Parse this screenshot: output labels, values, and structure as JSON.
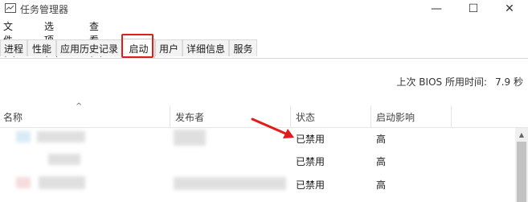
{
  "window": {
    "title": "任务管理器"
  },
  "controls": {
    "minimize": "—",
    "maximize": "☐",
    "close": "✕"
  },
  "menu": {
    "file": "文件(F)",
    "options": "选项(O)",
    "view": "查看(V)"
  },
  "tabs": [
    {
      "label": "进程"
    },
    {
      "label": "性能"
    },
    {
      "label": "应用历史记录"
    },
    {
      "label": "启动",
      "selected": true
    },
    {
      "label": "用户"
    },
    {
      "label": "详细信息"
    },
    {
      "label": "服务"
    }
  ],
  "bios": {
    "label": "上次 BIOS 所用时间:",
    "value": "7.9 秒"
  },
  "columns": {
    "sort_indicator": "^",
    "name": "名称",
    "publisher": "发布者",
    "status": "状态",
    "impact": "启动影响"
  },
  "rows": [
    {
      "status": "已禁用",
      "impact": "高"
    },
    {
      "status": "已禁用",
      "impact": "高"
    },
    {
      "status": "已禁用",
      "impact": "高"
    }
  ],
  "colors": {
    "highlight": "#e21b1b",
    "arrow": "#e21b1b"
  }
}
